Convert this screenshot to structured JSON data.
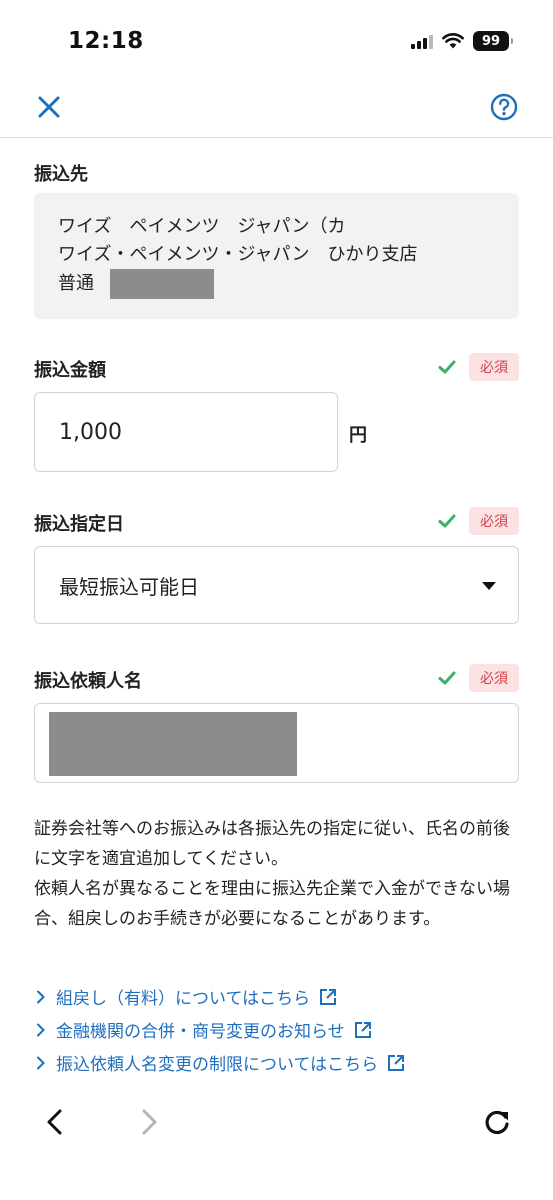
{
  "status_bar": {
    "time": "12:18",
    "battery": "99"
  },
  "nav": {
    "close_icon": "close-icon",
    "help_icon": "help-icon",
    "accent_color": "#1f6fbf"
  },
  "payee": {
    "label": "振込先",
    "line1": "ワイズ　ペイメンツ　ジャパン（カ",
    "line2": "ワイズ・ペイメンツ・ジャパン　ひかり支店",
    "account_type": "普通"
  },
  "amount": {
    "label": "振込金額",
    "required": "必須",
    "value": "1,000",
    "unit": "円"
  },
  "transfer_date": {
    "label": "振込指定日",
    "required": "必須",
    "value": "最短振込可能日"
  },
  "requester": {
    "label": "振込依頼人名",
    "required": "必須"
  },
  "notice": {
    "paragraph1": "証券会社等へのお振込みは各振込先の指定に従い、氏名の前後に文字を適宜追加してください。",
    "paragraph2": "依頼人名が異なることを理由に振込先企業で入金ができない場合、組戻しのお手続きが必要になることがあります。"
  },
  "links": [
    {
      "label": "組戻し（有料）についてはこちら"
    },
    {
      "label": "金融機関の合併・商号変更のお知らせ"
    },
    {
      "label": "振込依頼人名変更の制限についてはこちら"
    }
  ],
  "colors": {
    "check": "#3cae6e",
    "required_bg": "#fbe3e4",
    "required_text": "#d2404a",
    "link": "#1f6fbf"
  }
}
